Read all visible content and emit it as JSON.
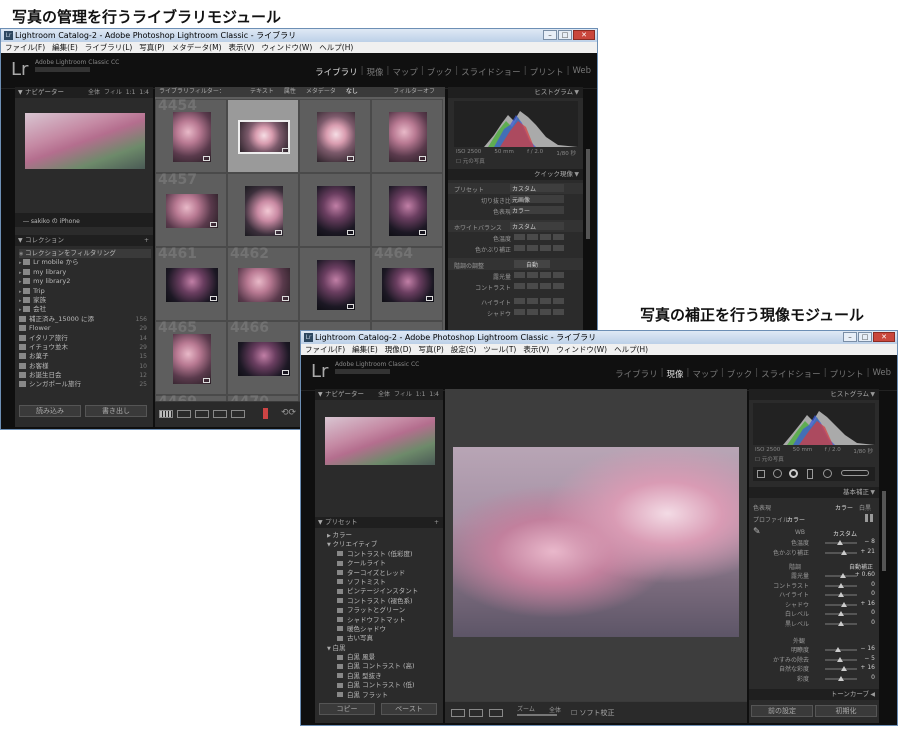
{
  "captions": {
    "library": "写真の管理を行うライブラリモジュール",
    "develop": "写真の補正を行う現像モジュール"
  },
  "colors": {
    "window_border": "#6d8fb5",
    "panel_bg": "#2b2b2b",
    "grid_bg": "#5e5e5e",
    "accent_bg": "#0f0f0f"
  },
  "library_window": {
    "title": "Lightroom Catalog-2 - Adobe Photoshop Lightroom Classic - ライブラリ",
    "menu": [
      "ファイル(F)",
      "編集(E)",
      "ライブラリ(L)",
      "写真(P)",
      "メタデータ(M)",
      "表示(V)",
      "ウィンドウ(W)",
      "ヘルプ(H)"
    ],
    "identity": "Adobe Lightroom Classic CC",
    "logo": "Lr",
    "modules": [
      "ライブラリ",
      "現像",
      "マップ",
      "ブック",
      "スライドショー",
      "プリント",
      "Web"
    ],
    "navigator_title": "ナビゲーター",
    "navigator_zoom": [
      "全体",
      "フィル",
      "1:1",
      "1:4"
    ],
    "device": "― sakiko の iPhone",
    "collections_title": "コレクション",
    "collections": [
      {
        "name": "コレクションをフィルタリング",
        "count": ""
      },
      {
        "name": "Lr mobile から",
        "count": ""
      },
      {
        "name": "my library",
        "count": ""
      },
      {
        "name": "my library2",
        "count": ""
      },
      {
        "name": "Trip",
        "count": ""
      },
      {
        "name": "家族",
        "count": ""
      },
      {
        "name": "会社",
        "count": ""
      },
      {
        "name": "補正済み_15000 に添",
        "count": "156"
      },
      {
        "name": "Flower",
        "count": "29"
      },
      {
        "name": "イタリア旅行",
        "count": "14"
      },
      {
        "name": "イチョウ並木",
        "count": "29"
      },
      {
        "name": "お菓子",
        "count": "15"
      },
      {
        "name": "お客様",
        "count": "10"
      },
      {
        "name": "お誕生日会",
        "count": "12"
      },
      {
        "name": "シンガポール旅行",
        "count": "25"
      }
    ],
    "import_button": "読み込み",
    "export_button": "書き出し",
    "filter_bar": {
      "label": "ライブラリフィルター：",
      "tabs": [
        "テキスト",
        "属性",
        "メタデータ",
        "なし"
      ],
      "right": "フィルターオフ"
    },
    "grid_numbers": [
      "4454",
      "",
      "",
      "",
      "4457",
      "",
      "",
      "",
      "4461",
      "4462",
      "",
      "4464",
      "4465",
      "4466",
      "",
      "",
      "4469",
      "4470",
      "",
      ""
    ],
    "histogram_title": "ヒストグラム",
    "histogram_info": [
      "ISO 2500",
      "50 mm",
      "f / 2.0",
      "1/80 秒"
    ],
    "original_photo": "元の写真",
    "quick_develop_title": "クイック現像",
    "quick_develop": {
      "preset_label": "プリセット",
      "preset_value": "カスタム",
      "crop_label": "切り抜き比",
      "crop_value": "元画像",
      "treatment_label": "色表現",
      "treatment_value": "カラー",
      "wb_label": "ホワイトバランス",
      "wb_value": "カスタム",
      "temp_label": "色温度",
      "tint_label": "色かぶり補正",
      "tone_label": "階調の調整",
      "auto_label": "自動",
      "exposure_label": "露光量",
      "contrast_label": "コントラスト",
      "highlights_label": "ハイライト",
      "shadows_label": "シャドウ"
    }
  },
  "develop_window": {
    "title": "Lightroom Catalog-2 - Adobe Photoshop Lightroom Classic - ライブラリ",
    "menu": [
      "ファイル(F)",
      "編集(E)",
      "現像(D)",
      "写真(P)",
      "設定(S)",
      "ツール(T)",
      "表示(V)",
      "ウィンドウ(W)",
      "ヘルプ(H)"
    ],
    "identity": "Adobe Lightroom Classic CC",
    "logo": "Lr",
    "modules": [
      "ライブラリ",
      "現像",
      "マップ",
      "ブック",
      "スライドショー",
      "プリント",
      "Web"
    ],
    "navigator_title": "ナビゲーター",
    "navigator_zoom": [
      "全体",
      "フィル",
      "1:1",
      "1:4"
    ],
    "presets_title": "プリセット",
    "presets": [
      {
        "name": "カラー",
        "kind": "group-closed"
      },
      {
        "name": "クリエイティブ",
        "kind": "group-open"
      },
      {
        "name": "コントラスト (低彩度)",
        "kind": "item"
      },
      {
        "name": "クールライト",
        "kind": "item"
      },
      {
        "name": "ターコイズとレッド",
        "kind": "item"
      },
      {
        "name": "ソフトミスト",
        "kind": "item"
      },
      {
        "name": "ピンテージインスタント",
        "kind": "item"
      },
      {
        "name": "コントラスト (褪色系)",
        "kind": "item"
      },
      {
        "name": "フラットとグリーン",
        "kind": "item"
      },
      {
        "name": "シャドウフトマット",
        "kind": "item"
      },
      {
        "name": "暖色シャドウ",
        "kind": "item"
      },
      {
        "name": "古い写真",
        "kind": "item"
      },
      {
        "name": "白黒",
        "kind": "group-open"
      },
      {
        "name": "白黒 風景",
        "kind": "item"
      },
      {
        "name": "白黒 コントラスト (高)",
        "kind": "item"
      },
      {
        "name": "白黒 型抜き",
        "kind": "item"
      },
      {
        "name": "白黒 コントラスト (低)",
        "kind": "item"
      },
      {
        "name": "白黒 フラット",
        "kind": "item"
      }
    ],
    "copy_button": "コピー",
    "paste_button": "ペースト",
    "toolbar": {
      "zoom_label": "ズーム",
      "zoom_value": "全体",
      "softproof": "ソフト校正"
    },
    "histogram_title": "ヒストグラム",
    "histogram_info": [
      "ISO 2500",
      "50 mm",
      "f / 2.0",
      "1/80 秒"
    ],
    "original_photo": "元の写真",
    "basic_title": "基本補正",
    "treatment_label": "色表現",
    "treatment_color": "カラー",
    "treatment_bw": "白黒",
    "profile_label": "プロファイル",
    "profile_value": "カラー",
    "wb_label": "WB",
    "wb_value": "カスタム",
    "wb_sliders": [
      {
        "label": "色温度",
        "value": "− 8",
        "pos": 0.47
      },
      {
        "label": "色かぶり補正",
        "value": "+ 21",
        "pos": 0.58
      }
    ],
    "tone_label": "階調",
    "auto_label": "自動補正",
    "tone_sliders": [
      {
        "label": "露光量",
        "value": "+ 0.60",
        "pos": 0.55
      },
      {
        "label": "コントラスト",
        "value": "0",
        "pos": 0.5
      },
      {
        "label": "ハイライト",
        "value": "0",
        "pos": 0.5
      },
      {
        "label": "シャドウ",
        "value": "+ 16",
        "pos": 0.58
      },
      {
        "label": "白レベル",
        "value": "0",
        "pos": 0.5
      },
      {
        "label": "黒レベル",
        "value": "0",
        "pos": 0.5
      }
    ],
    "presence_label": "外観",
    "presence_sliders": [
      {
        "label": "明瞭度",
        "value": "− 16",
        "pos": 0.42
      },
      {
        "label": "かすみの除去",
        "value": "− 5",
        "pos": 0.47
      },
      {
        "label": "自然な彩度",
        "value": "+ 16",
        "pos": 0.58
      },
      {
        "label": "彩度",
        "value": "0",
        "pos": 0.5
      }
    ],
    "tone_curve_title": "トーンカーブ",
    "previous_button": "前の設定",
    "reset_button": "初期化"
  }
}
